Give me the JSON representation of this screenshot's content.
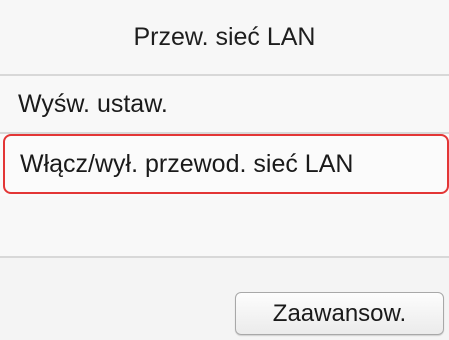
{
  "header": {
    "title": "Przew. sieć LAN"
  },
  "menu": {
    "items": [
      {
        "label": "Wyśw. ustaw."
      },
      {
        "label": "Włącz/wył. przewod. sieć LAN",
        "selected": true
      }
    ]
  },
  "footer": {
    "advanced_label": "Zaawansow."
  },
  "colors": {
    "selection_border": "#e33636"
  }
}
